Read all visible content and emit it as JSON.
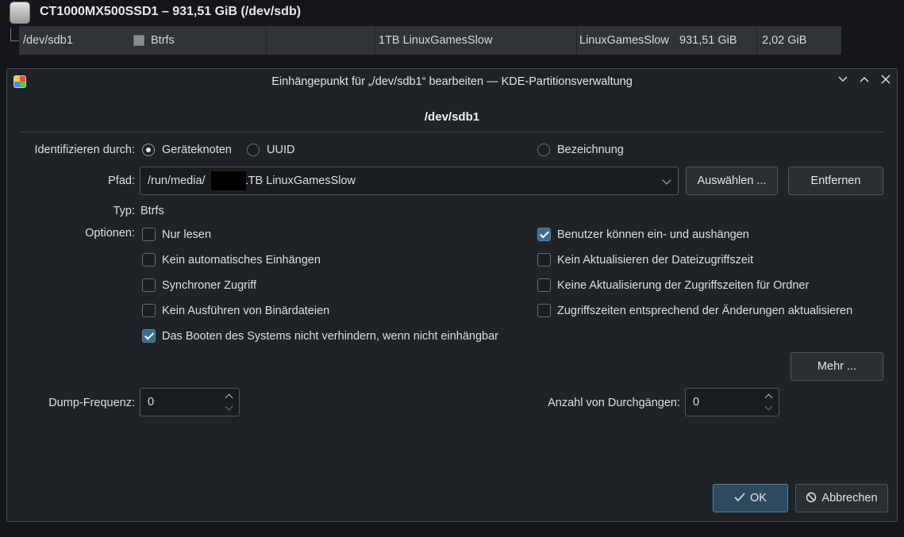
{
  "background": {
    "disk_title": "CT1000MX500SSD1 – 931,51 GiB (/dev/sdb)",
    "partition_row": {
      "device": "/dev/sdb1",
      "filesystem": "Btrfs",
      "mountpoint": "1TB LinuxGamesSlow",
      "label": "LinuxGamesSlow",
      "size": "931,51 GiB",
      "used": "2,02 GiB"
    }
  },
  "dialog": {
    "title": "Einhängepunkt für „/dev/sdb1“ bearbeiten — KDE-Partitionsverwaltung",
    "titlebar_buttons": [
      "minimize-icon",
      "maximize-icon",
      "close-icon"
    ],
    "heading": "/dev/sdb1",
    "identify": {
      "label": "Identifizieren durch:",
      "options": [
        {
          "label": "Geräteknoten",
          "selected": true
        },
        {
          "label": "UUID",
          "selected": false
        },
        {
          "label": "Bezeichnung",
          "selected": false
        }
      ]
    },
    "path": {
      "label": "Pfad:",
      "value_prefix": "/run/media/",
      "value_suffix": "/1TB LinuxGamesSlow",
      "choose_button": "Auswählen ...",
      "remove_button": "Entfernen"
    },
    "type": {
      "label": "Typ:",
      "value": "Btrfs"
    },
    "options_label": "Optionen:",
    "options_left": [
      {
        "label": "Nur lesen",
        "checked": false
      },
      {
        "label": "Kein automatisches Einhängen",
        "checked": false
      },
      {
        "label": "Synchroner Zugriff",
        "checked": false
      },
      {
        "label": "Kein Ausführen von Binärdateien",
        "checked": false
      },
      {
        "label": "Das Booten des Systems nicht verhindern, wenn nicht einhängbar",
        "checked": true
      }
    ],
    "options_right": [
      {
        "label": "Benutzer können ein- und aushängen",
        "checked": true
      },
      {
        "label": "Kein Aktualisieren der Dateizugriffszeit",
        "checked": false
      },
      {
        "label": "Keine Aktualisierung der Zugriffszeiten für Ordner",
        "checked": false
      },
      {
        "label": "Zugriffszeiten entsprechend der Änderungen aktualisieren",
        "checked": false
      }
    ],
    "more_button": "Mehr ...",
    "dump": {
      "label": "Dump-Frequenz:",
      "value": "0"
    },
    "passes": {
      "label": "Anzahl von Durchgängen:",
      "value": "0"
    },
    "ok_button": "OK",
    "cancel_button": "Abbrechen",
    "accent_color": "#3d6d91"
  }
}
